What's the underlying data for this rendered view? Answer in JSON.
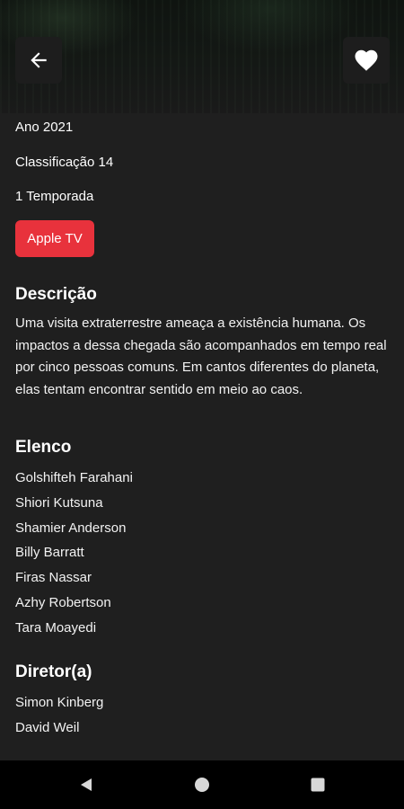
{
  "header": {
    "back_icon": "arrow-left-icon",
    "favorite_icon": "heart-icon"
  },
  "details": {
    "year": "Ano 2021",
    "rating": "Classificação 14",
    "seasons": "1 Temporada",
    "provider_button": "Apple TV"
  },
  "description": {
    "title": "Descrição",
    "text": "Uma visita extraterrestre ameaça a existência humana. Os impactos a dessa chegada são acompanhados em tempo real por cinco pessoas comuns. Em cantos diferentes do planeta, elas tentam encontrar sentido em meio ao caos."
  },
  "cast": {
    "title": "Elenco",
    "members": [
      "Golshifteh Farahani",
      "Shiori Kutsuna",
      "Shamier Anderson",
      "Billy Barratt",
      "Firas Nassar",
      "Azhy Robertson",
      "Tara Moayedi"
    ]
  },
  "directors": {
    "title": "Diretor(a)",
    "names": [
      "Simon Kinberg",
      "David Weil"
    ]
  },
  "navigation": {
    "back_icon": "triangle-back-icon",
    "home_icon": "circle-home-icon",
    "recents_icon": "square-recents-icon"
  },
  "colors": {
    "background": "#1f1f1f",
    "accent": "#e8323c",
    "navbar": "#000000"
  }
}
